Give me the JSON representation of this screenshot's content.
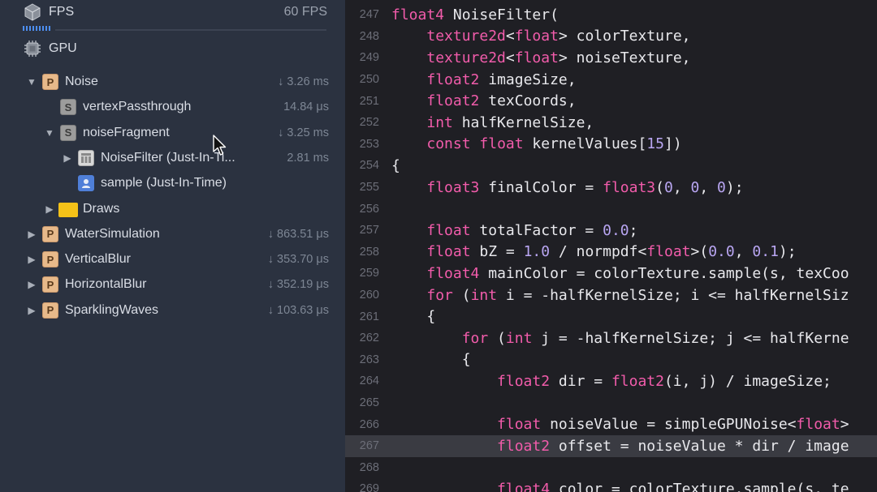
{
  "navigator": {
    "fps": {
      "label": "FPS",
      "value": "60 FPS",
      "icon": "fps-cube-icon"
    },
    "gpu": {
      "label": "GPU",
      "icon": "chip-icon"
    },
    "tree": [
      {
        "label": "Noise",
        "time": "↓ 3.26 ms",
        "icon": "P",
        "indent": 0,
        "disclosure": "expanded"
      },
      {
        "label": "vertexPassthrough",
        "time": "14.84 μs",
        "icon": "S",
        "indent": 1,
        "disclosure": "none"
      },
      {
        "label": "noiseFragment",
        "time": "↓ 3.25 ms",
        "icon": "S",
        "indent": 1,
        "disclosure": "expanded"
      },
      {
        "label": "NoiseFilter (Just-In-Ti...",
        "time": "2.81 ms",
        "icon": "F",
        "indent": 2,
        "disclosure": "collapsed"
      },
      {
        "label": "sample (Just-In-Time)",
        "time": "",
        "icon": "U",
        "indent": 2,
        "disclosure": "none"
      },
      {
        "label": "Draws",
        "time": "",
        "icon": "folder",
        "indent": 1,
        "disclosure": "collapsed"
      },
      {
        "label": "WaterSimulation",
        "time": "↓ 863.51 μs",
        "icon": "P",
        "indent": 0,
        "disclosure": "collapsed"
      },
      {
        "label": "VerticalBlur",
        "time": "↓ 353.70 μs",
        "icon": "P",
        "indent": 0,
        "disclosure": "collapsed"
      },
      {
        "label": "HorizontalBlur",
        "time": "↓ 352.19 μs",
        "icon": "P",
        "indent": 0,
        "disclosure": "collapsed"
      },
      {
        "label": "SparklingWaves",
        "time": "↓ 103.63 μs",
        "icon": "P",
        "indent": 0,
        "disclosure": "collapsed"
      }
    ]
  },
  "editor": {
    "highlighted_line": 267,
    "lines": [
      {
        "n": "247",
        "code": "float4 NoiseFilter("
      },
      {
        "n": "248",
        "code": "    texture2d<float> colorTexture,"
      },
      {
        "n": "249",
        "code": "    texture2d<float> noiseTexture,"
      },
      {
        "n": "250",
        "code": "    float2 imageSize,"
      },
      {
        "n": "251",
        "code": "    float2 texCoords,"
      },
      {
        "n": "252",
        "code": "    int halfKernelSize,"
      },
      {
        "n": "253",
        "code": "    const float kernelValues[15])"
      },
      {
        "n": "254",
        "code": "{"
      },
      {
        "n": "255",
        "code": "    float3 finalColor = float3(0, 0, 0);"
      },
      {
        "n": "256",
        "code": ""
      },
      {
        "n": "257",
        "code": "    float totalFactor = 0.0;"
      },
      {
        "n": "258",
        "code": "    float bZ = 1.0 / normpdf<float>(0.0, 0.1);"
      },
      {
        "n": "259",
        "code": "    float4 mainColor = colorTexture.sample(s, texCoo"
      },
      {
        "n": "260",
        "code": "    for (int i = -halfKernelSize; i <= halfKernelSiz"
      },
      {
        "n": "261",
        "code": "    {"
      },
      {
        "n": "262",
        "code": "        for (int j = -halfKernelSize; j <= halfKerne"
      },
      {
        "n": "263",
        "code": "        {"
      },
      {
        "n": "264",
        "code": "            float2 dir = float2(i, j) / imageSize;"
      },
      {
        "n": "265",
        "code": ""
      },
      {
        "n": "266",
        "code": "            float noiseValue = simpleGPUNoise<float>"
      },
      {
        "n": "267",
        "code": "            float2 offset = noiseValue * dir / image"
      },
      {
        "n": "268",
        "code": ""
      },
      {
        "n": "269",
        "code": "            float4 color = colorTexture.sample(s, te"
      }
    ]
  }
}
